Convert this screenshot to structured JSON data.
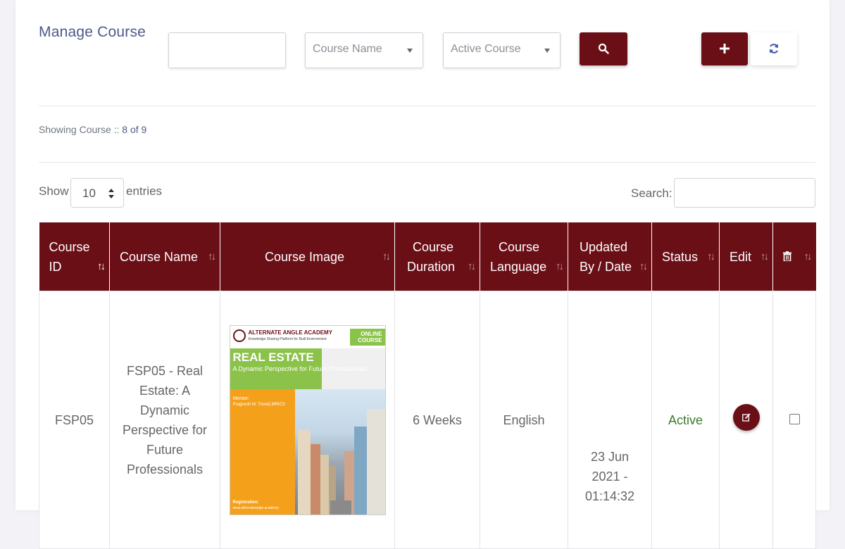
{
  "header": {
    "title": "Manage Course",
    "search_value": "",
    "course_name_select": "Course Name",
    "status_select": "Active Course"
  },
  "summary": {
    "label": "Showing Course :: ",
    "count": "8 of 9"
  },
  "table_controls": {
    "show_label": "Show",
    "entries_value": "10",
    "entries_label": "entries",
    "search_label": "Search:",
    "search_value": ""
  },
  "columns": [
    {
      "line1": "Course",
      "line2": "ID"
    },
    {
      "line1": "Course Name",
      "line2": ""
    },
    {
      "line1": "Course Image",
      "line2": ""
    },
    {
      "line1": "Course",
      "line2": "Duration"
    },
    {
      "line1": "Course",
      "line2": "Language"
    },
    {
      "line1": "Updated",
      "line2": "By / Date"
    },
    {
      "line1": "Status",
      "line2": ""
    },
    {
      "line1": "Edit",
      "line2": ""
    }
  ],
  "rows": [
    {
      "id": "FSP05",
      "name": "FSP05 - Real Estate: A Dynamic Perspective for Future Professionals",
      "duration": "6 Weeks",
      "language": "English",
      "updated_by": "",
      "updated_date": "23 Jun 2021 - 01:14:32",
      "status": "Active",
      "image": {
        "academy": "ALTERNATE ANGLE ACADEMY",
        "tagline": "Knowledge Sharing Platform for Built Environment",
        "online": "ONLINE COURSE",
        "title": "REAL ESTATE",
        "subtitle": "A Dynamic Perspective for Future Professionals",
        "mentor_label": "Mentor:",
        "mentor_name": "Pragnesh M. Trivedi,MRICS",
        "registration_label": "Registration:",
        "registration_url": "www.alternateangle.academy"
      }
    }
  ],
  "colors": {
    "primary": "#6b0f17",
    "title": "#4d5a8a",
    "status_active": "#3a7a2a"
  }
}
